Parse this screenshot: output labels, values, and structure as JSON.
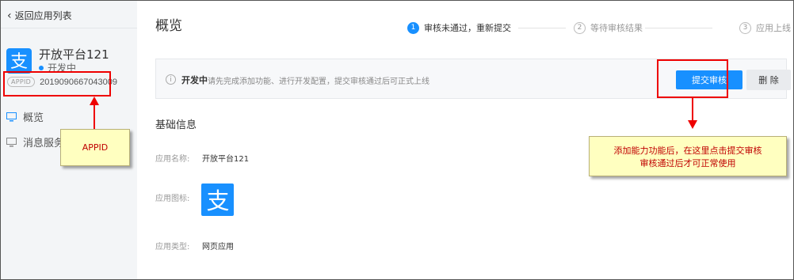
{
  "sidebar": {
    "back_label": "返回应用列表",
    "app_name": "开放平台121",
    "app_status": "开发中",
    "appid_badge": "APPID",
    "appid_value": "2019090667043009",
    "nav": [
      {
        "label": "概览",
        "icon": "monitor-icon"
      },
      {
        "label": "消息服务",
        "icon": "monitor-icon"
      }
    ]
  },
  "main": {
    "title": "概览",
    "steps": [
      {
        "num": "1",
        "label": "审核未通过，重新提交",
        "state": "active"
      },
      {
        "num": "2",
        "label": "等待审核结果",
        "state": "inactive"
      },
      {
        "num": "3",
        "label": "应用上线",
        "state": "inactive"
      }
    ],
    "info_bar": {
      "icon": "info-icon",
      "status": "开发中",
      "message": "请先完成添加功能、进行开发配置，提交审核通过后可正式上线",
      "submit_label": "提交审核",
      "delete_label": "删 除"
    },
    "basic_info": {
      "title": "基础信息",
      "name_label": "应用名称:",
      "name_value": "开放平台121",
      "icon_label": "应用图标:",
      "type_label": "应用类型:",
      "type_value": "网页应用"
    }
  },
  "annotations": {
    "appid_callout": "APPID",
    "submit_callout_line1": "添加能力功能后，在这里点击提交审核",
    "submit_callout_line2": "审核通过后才可正常使用"
  },
  "colors": {
    "accent": "#1890ff",
    "annotation_red": "#e00000",
    "callout_bg": "#ffffc0"
  }
}
